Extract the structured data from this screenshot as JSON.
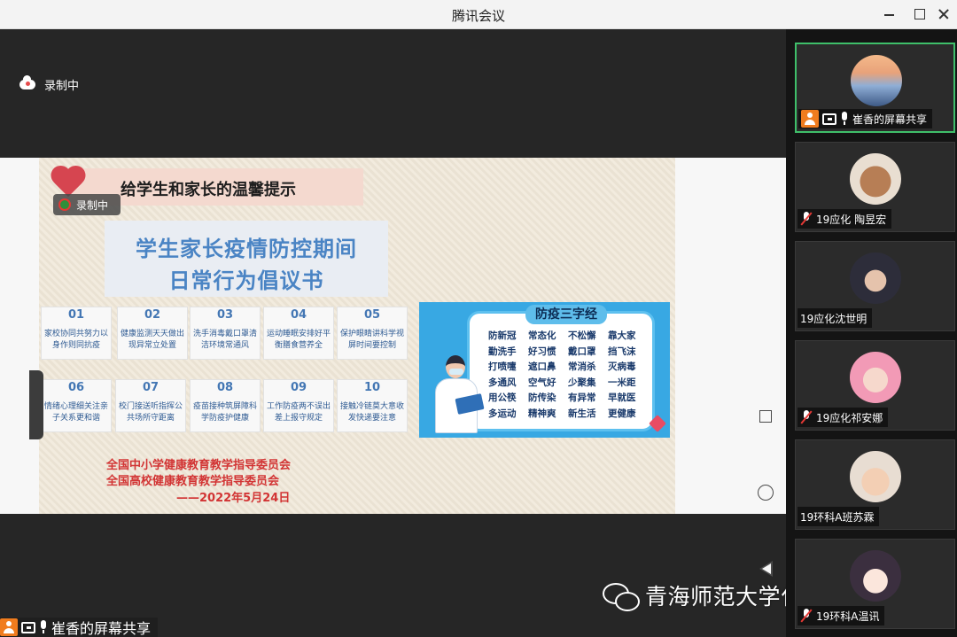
{
  "window": {
    "title": "腾讯会议"
  },
  "recording": {
    "label": "录制中"
  },
  "slide": {
    "heading": "给学生和家长的温馨提示",
    "title_line1": "学生家长疫情防控期间",
    "title_line2": "日常行为倡议书",
    "cards": [
      {
        "num": "01",
        "text": "家校协同共努力以身作则同抗疫"
      },
      {
        "num": "02",
        "text": "健康监测天天做出现异常立处置"
      },
      {
        "num": "03",
        "text": "洗手消毒戴口罩清洁环境常通风"
      },
      {
        "num": "04",
        "text": "运动睡眠安排好平衡膳食营养全"
      },
      {
        "num": "05",
        "text": "保护眼睛讲科学视屏时间要控制"
      },
      {
        "num": "06",
        "text": "情绪心理细关注亲子关系更和谐"
      },
      {
        "num": "07",
        "text": "校门接送听指挥公共场所守距离"
      },
      {
        "num": "08",
        "text": "疫苗接种筑屏障科学防疫护健康"
      },
      {
        "num": "09",
        "text": "工作防疫两不误出差上报守规定"
      },
      {
        "num": "10",
        "text": "接触冷链莫大意收发快递要注意"
      }
    ],
    "footer_line1": "全国中小学健康教育教学指导委员会",
    "footer_line2": "全国高校健康教育教学指导委员会",
    "footer_line3": "——2022年5月24日",
    "poster": {
      "title": "防疫三字经",
      "lines": [
        "防新冠",
        "常态化",
        "不松懈",
        "靠大家",
        "勤洗手",
        "好习惯",
        "戴口罩",
        "挡飞沫",
        "打喷嚏",
        "遮口鼻",
        "常消杀",
        "灭病毒",
        "多通风",
        "空气好",
        "少聚集",
        "一米距",
        "用公筷",
        "防传染",
        "有异常",
        "早就医",
        "多运动",
        "精神爽",
        "新生活",
        "更健康"
      ]
    }
  },
  "sharer": {
    "name": "崔香的屏幕共享"
  },
  "watermark": "青海师范大学化学化工学院",
  "participants": [
    {
      "name": "崔香的屏幕共享",
      "active": true,
      "mic": "on"
    },
    {
      "name": "19应化 陶昱宏",
      "active": false,
      "mic": "off"
    },
    {
      "name": "19应化沈世明",
      "active": false,
      "mic": "none"
    },
    {
      "name": "19应化祁安娜",
      "active": false,
      "mic": "off"
    },
    {
      "name": "19环科A班苏霖",
      "active": false,
      "mic": "none"
    },
    {
      "name": "19环科A温讯",
      "active": false,
      "mic": "off"
    }
  ],
  "colors": {
    "active_border": "#3fbf6a",
    "accent_orange": "#f07c1e",
    "slide_red": "#d23434"
  }
}
